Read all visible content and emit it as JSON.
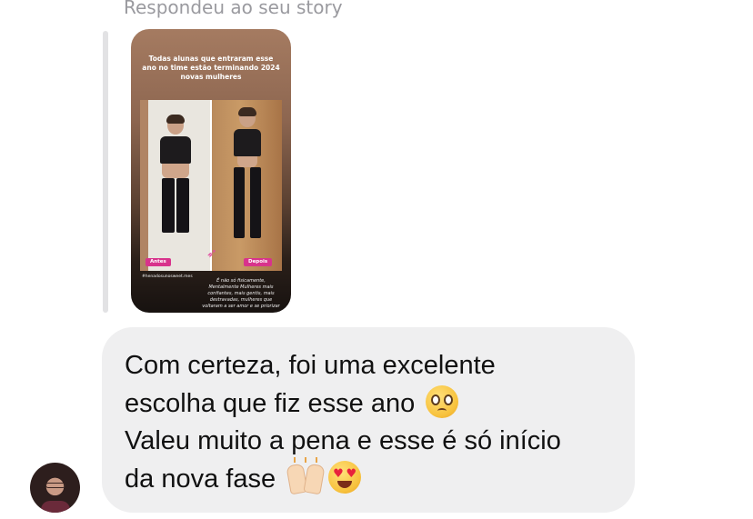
{
  "reply_label": "Respondeu ao seu story",
  "story": {
    "headline": "Todas alunas que entraram esse ano no time estão terminando 2024 novas mulheres",
    "tag_before": "Antes",
    "tag_after": "Depois",
    "handle": "#henadosunosweet.mes",
    "caption": "É não só fisicamente, Mentalmente Mulheres mais confiantes, mais gentis, mais destravadas, mulheres que voltaram a ser amor e se priorizar"
  },
  "message": {
    "line1": "Com certeza, foi uma excelente",
    "line2": "escolha que fiz esse ano",
    "line3": "Valeu muito a pena e esse é só início",
    "line4": "da nova fase",
    "emoji_line2": "pleading-face-icon",
    "emoji_line4a": "raising-hands-icon",
    "emoji_line4b": "heart-eyes-icon"
  },
  "colors": {
    "bubble": "#efeff0",
    "text": "#111111",
    "reply_label": "#9a9a9f",
    "tag": "#d8338c"
  }
}
